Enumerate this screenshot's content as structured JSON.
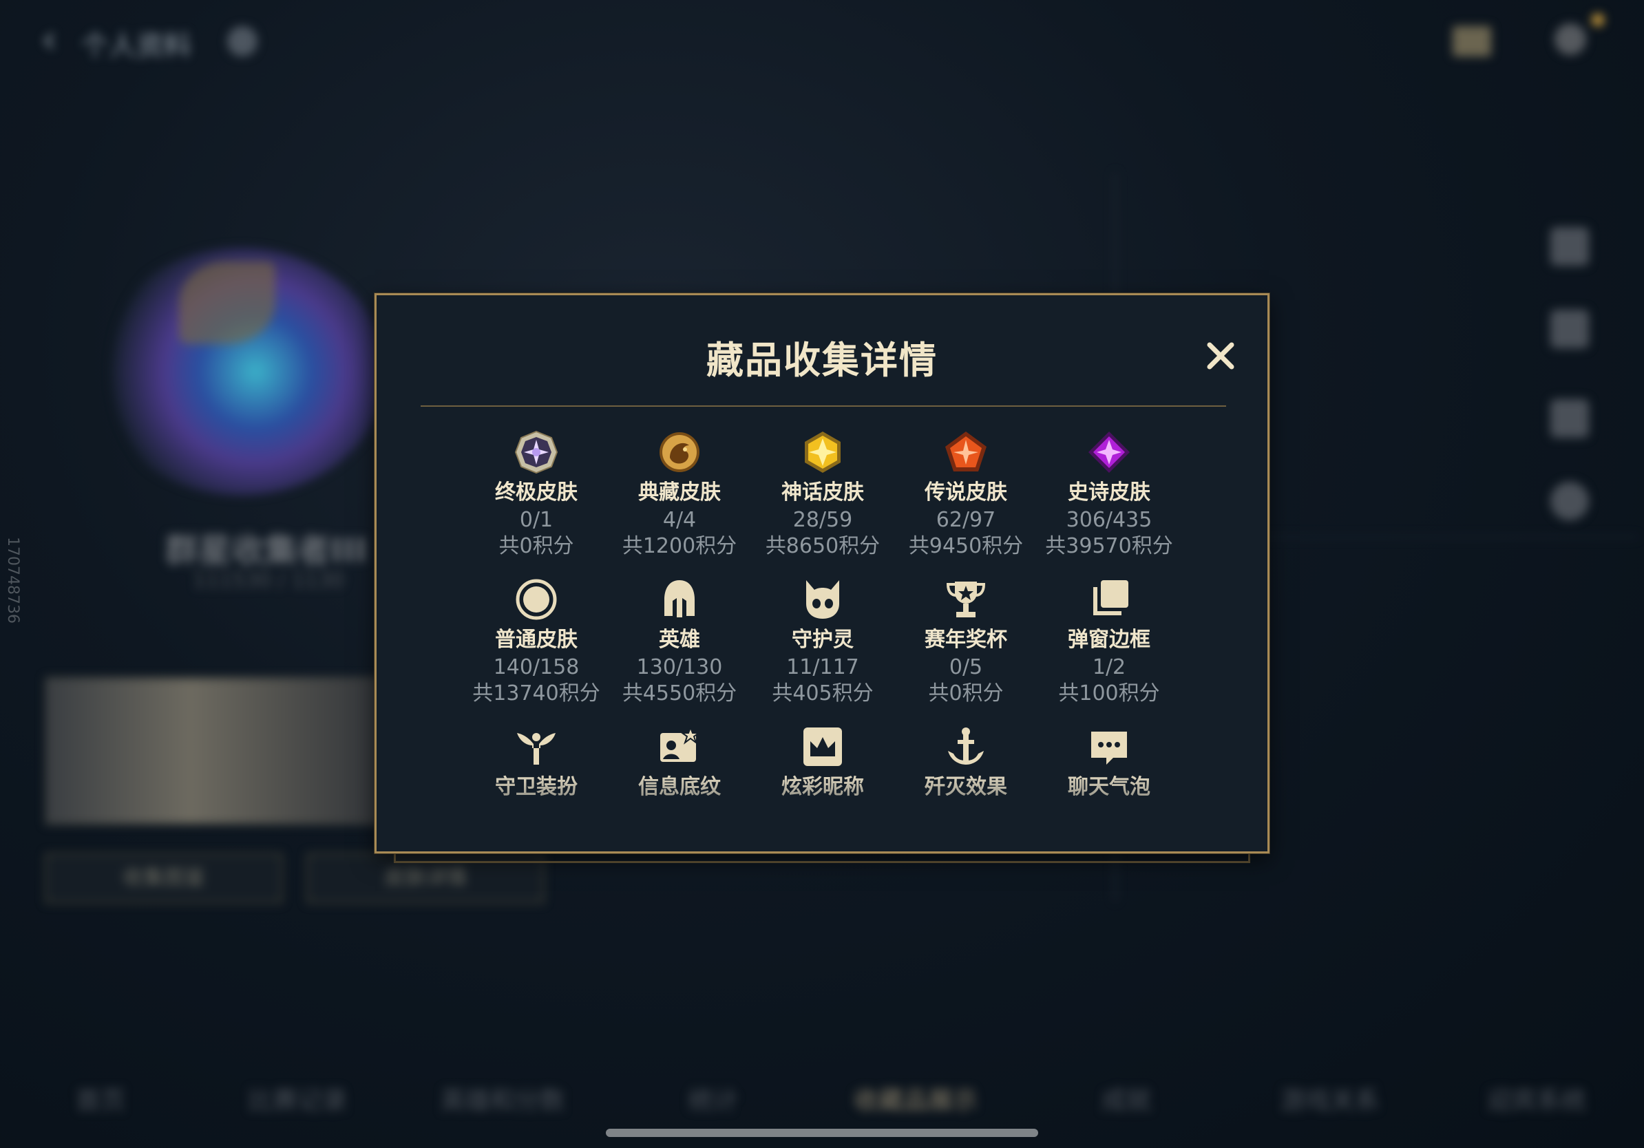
{
  "background": {
    "header_title": "个人资料",
    "player_name": "群星收集者III",
    "player_sub": "111530 / 1130",
    "side_id": "170748736",
    "buttons": [
      "收集图鉴",
      "皮肤详情"
    ],
    "tabs": [
      "首页",
      "比赛记录",
      "英雄和分数",
      "统计",
      "收藏品展示",
      "成就",
      "游戏关系",
      "迎宾系统"
    ],
    "active_tab_index": 4
  },
  "modal": {
    "title": "藏品收集详情",
    "close_label": "✕",
    "items": [
      {
        "icon": "ultimate-skin-icon",
        "name": "终极皮肤",
        "count": "0/1",
        "points": "共0积分"
      },
      {
        "icon": "prestige-skin-icon",
        "name": "典藏皮肤",
        "count": "4/4",
        "points": "共1200积分"
      },
      {
        "icon": "mythic-skin-icon",
        "name": "神话皮肤",
        "count": "28/59",
        "points": "共8650积分"
      },
      {
        "icon": "legendary-skin-icon",
        "name": "传说皮肤",
        "count": "62/97",
        "points": "共9450积分"
      },
      {
        "icon": "epic-skin-icon",
        "name": "史诗皮肤",
        "count": "306/435",
        "points": "共39570积分"
      },
      {
        "icon": "standard-skin-icon",
        "name": "普通皮肤",
        "count": "140/158",
        "points": "共13740积分"
      },
      {
        "icon": "champion-helmet-icon",
        "name": "英雄",
        "count": "130/130",
        "points": "共4550积分"
      },
      {
        "icon": "guardian-icon",
        "name": "守护灵",
        "count": "11/117",
        "points": "共405积分"
      },
      {
        "icon": "trophy-icon",
        "name": "赛年奖杯",
        "count": "0/5",
        "points": "共0积分"
      },
      {
        "icon": "popup-frame-icon",
        "name": "弹窗边框",
        "count": "1/2",
        "points": "共100积分"
      },
      {
        "icon": "ward-skin-icon",
        "name": "守卫装扮",
        "count": "",
        "points": ""
      },
      {
        "icon": "profile-banner-icon",
        "name": "信息底纹",
        "count": "",
        "points": ""
      },
      {
        "icon": "nickname-crown-icon",
        "name": "炫彩昵称",
        "count": "",
        "points": ""
      },
      {
        "icon": "finisher-effect-icon",
        "name": "歼灭效果",
        "count": "",
        "points": ""
      },
      {
        "icon": "chat-bubble-icon",
        "name": "聊天气泡",
        "count": "",
        "points": ""
      }
    ]
  },
  "colors": {
    "accent_gold": "#a88a55",
    "title_text": "#f1e6c8",
    "muted_text": "#8f989f",
    "modal_bg": "#141e28"
  }
}
